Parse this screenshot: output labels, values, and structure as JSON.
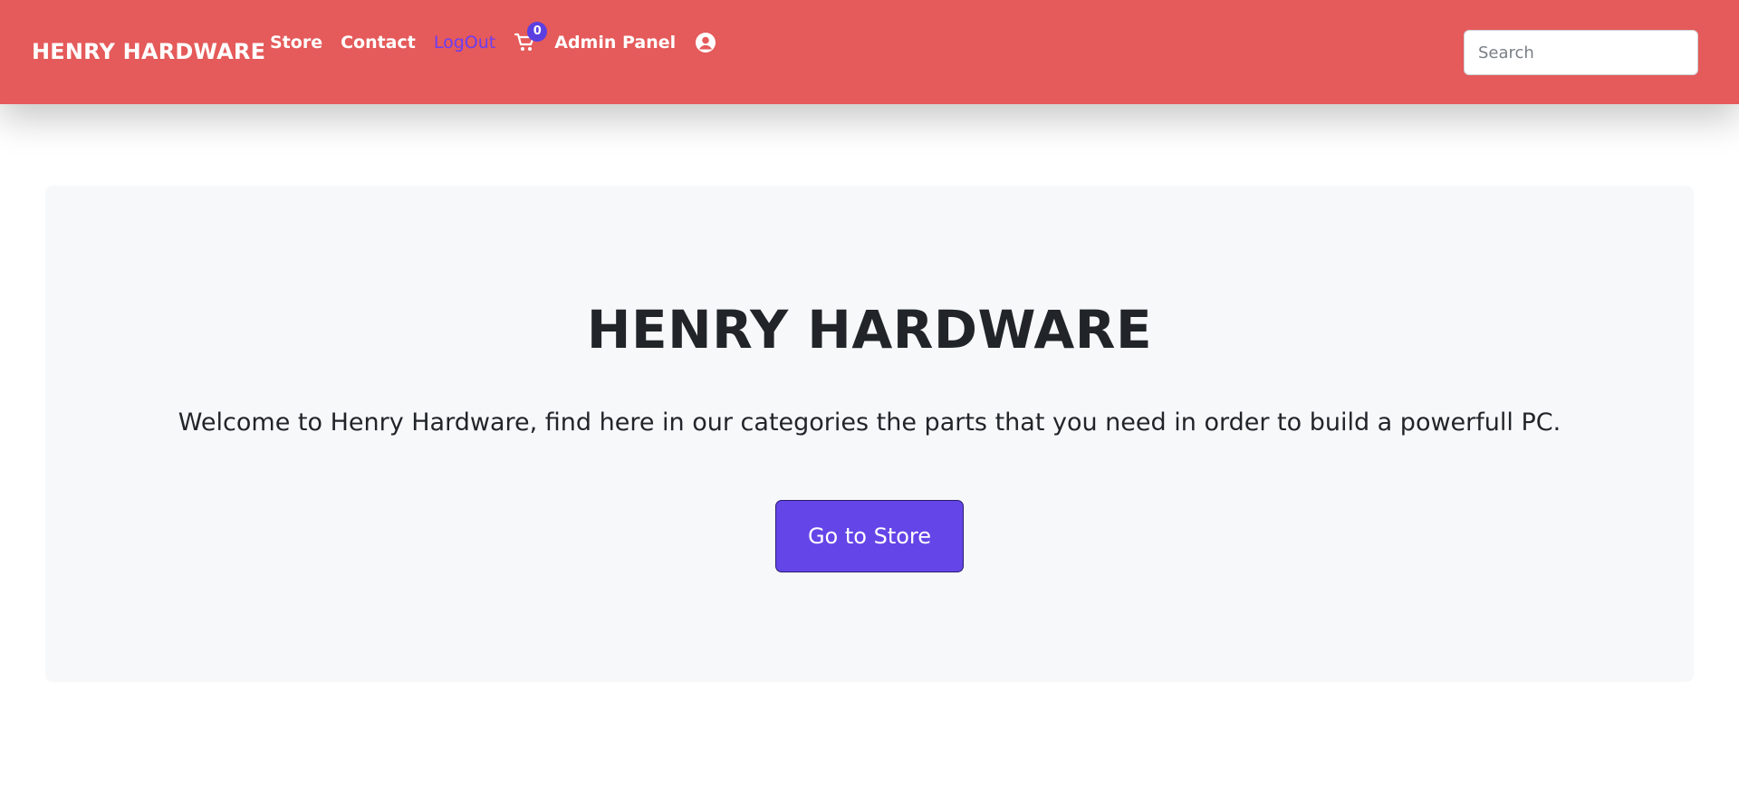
{
  "navbar": {
    "brand": "HENRY HARDWARE",
    "links": {
      "store": "Store",
      "contact": "Contact",
      "logout": "LogOut",
      "admin": "Admin Panel"
    },
    "cart_count": "0",
    "icons": {
      "cart": "shopping-cart-icon",
      "user": "user-circle-icon"
    }
  },
  "search": {
    "placeholder": "Search",
    "value": ""
  },
  "hero": {
    "title": "HENRY HARDWARE",
    "text": "Welcome to Henry Hardware, find here in our categories the parts that you need in order to build a powerfull PC.",
    "button_label": "Go to Store"
  },
  "colors": {
    "navbar_bg": "#e55a5a",
    "accent": "#6445e8",
    "logout_link": "#6b3df5",
    "hero_bg": "#f7f8fa"
  }
}
